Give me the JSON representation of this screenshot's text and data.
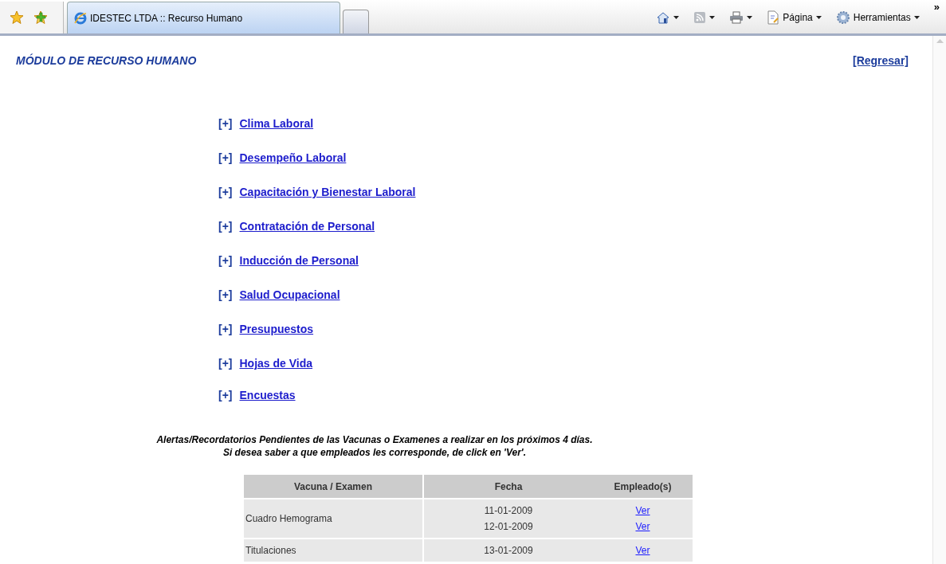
{
  "browser": {
    "tab_title": "IDESTEC LTDA :: Recurso Humano",
    "toolbar": [
      {
        "kind": "home"
      },
      {
        "kind": "feed"
      },
      {
        "kind": "print"
      },
      {
        "kind": "page",
        "label": "Página"
      },
      {
        "kind": "tools",
        "label": "Herramientas"
      }
    ],
    "overflow": "»"
  },
  "page": {
    "title": "MÓDULO DE RECURSO HUMANO",
    "back_link": "[Regresar]",
    "menu": [
      {
        "marker": "[+]",
        "label": "Clima Laboral"
      },
      {
        "marker": "[+]",
        "label": "Desempeño Laboral"
      },
      {
        "marker": "[+]",
        "label": "Capacitación y Bienestar Laboral"
      },
      {
        "marker": "[+]",
        "label": "Contratación de Personal"
      },
      {
        "marker": "[+]",
        "label": "Inducción de Personal"
      },
      {
        "marker": "[+]",
        "label": "Salud Ocupacional"
      },
      {
        "marker": "[+]",
        "label": "Presupuestos"
      },
      {
        "marker": "[+]",
        "label": "Hojas de Vida"
      },
      {
        "marker": "[+]",
        "label": "Encuestas"
      }
    ],
    "alert_lines": [
      "Alertas/Recordatorios Pendientes de las Vacunas o Examenes a realizar en los próximos 4 días.",
      "Si desea saber a que empleados les corresponde, de click en 'Ver'."
    ],
    "table": {
      "columns": [
        "Vacuna / Examen",
        "Fecha",
        "Empleado(s)"
      ],
      "rows": [
        {
          "name": "Cuadro Hemograma",
          "entries": [
            {
              "date": "11-01-2009",
              "link": "Ver"
            },
            {
              "date": "12-01-2009",
              "link": "Ver"
            }
          ]
        },
        {
          "name": "Titulaciones",
          "entries": [
            {
              "date": "13-01-2009",
              "link": "Ver"
            }
          ]
        }
      ]
    }
  }
}
